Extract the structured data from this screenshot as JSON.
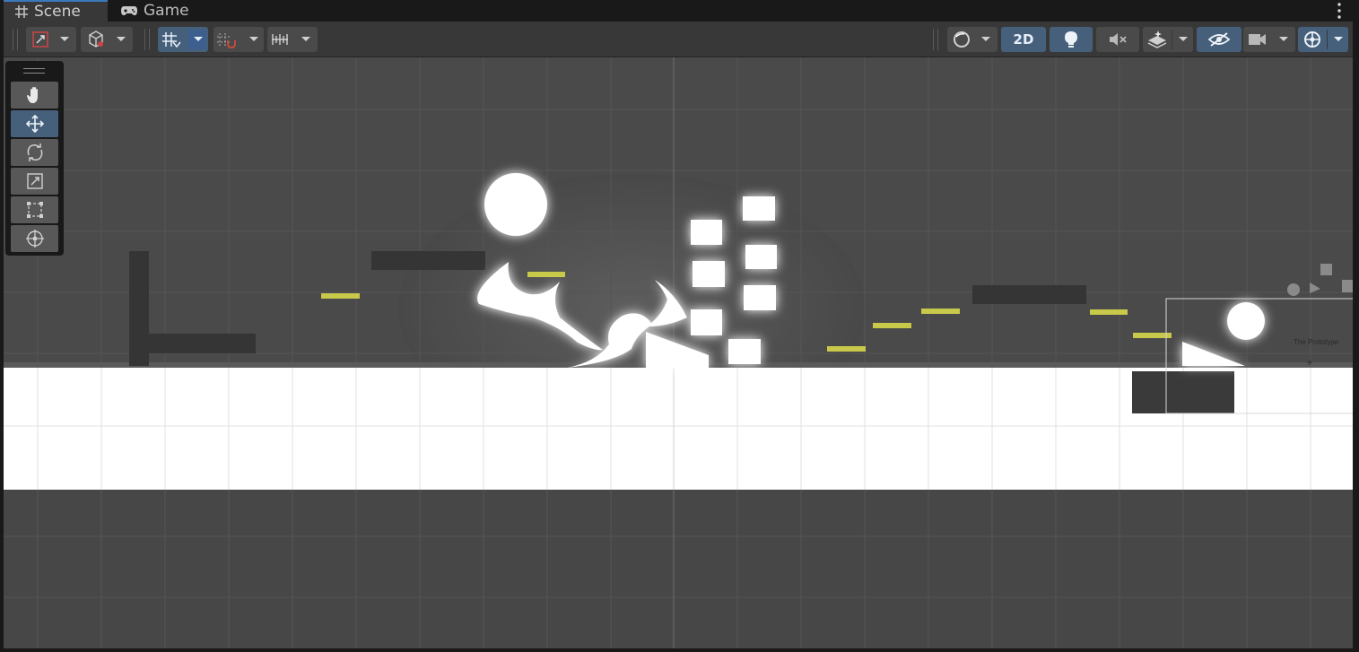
{
  "tabs": [
    {
      "label": "Scene",
      "icon": "grid-hash-icon",
      "active": true
    },
    {
      "label": "Game",
      "icon": "gamepad-icon",
      "active": false
    }
  ],
  "toolbar": {
    "view_2d_label": "2D",
    "left_buttons": [
      {
        "name": "transform-pivot-button",
        "icon": "pivot-icon",
        "dropdown": true,
        "active": false
      },
      {
        "name": "global-local-button",
        "icon": "cube-icon",
        "dropdown": true,
        "active": false
      },
      {
        "name": "grid-snapping-button",
        "icon": "grid-snap-icon",
        "dropdown": true,
        "active": true
      },
      {
        "name": "increment-snap-button",
        "icon": "snap-increment-icon",
        "dropdown": true,
        "active": false
      },
      {
        "name": "ruler-button",
        "icon": "ruler-icon",
        "dropdown": true,
        "active": false
      }
    ],
    "right_buttons": [
      {
        "name": "draw-mode-button",
        "icon": "shading-sphere-icon",
        "dropdown": true,
        "active": false
      },
      {
        "name": "2d-toggle-button",
        "icon": "",
        "dropdown": false,
        "active": true
      },
      {
        "name": "lighting-toggle-button",
        "icon": "lightbulb-icon",
        "dropdown": false,
        "active": true
      },
      {
        "name": "audio-toggle-button",
        "icon": "audio-mute-icon",
        "dropdown": false,
        "active": false
      },
      {
        "name": "effects-button",
        "icon": "layers-effects-icon",
        "dropdown": true,
        "active": false
      },
      {
        "name": "scene-visibility-button",
        "icon": "eye-hidden-icon",
        "dropdown": false,
        "active": true
      },
      {
        "name": "camera-button",
        "icon": "camera-icon",
        "dropdown": true,
        "active": false
      },
      {
        "name": "gizmos-button",
        "icon": "gizmo-globe-icon",
        "dropdown": true,
        "active": true
      }
    ]
  },
  "tools": [
    {
      "name": "hand-tool",
      "icon": "hand-icon",
      "active": false
    },
    {
      "name": "move-tool",
      "icon": "move-arrows-icon",
      "active": true
    },
    {
      "name": "rotate-tool",
      "icon": "rotate-icon",
      "active": false
    },
    {
      "name": "scale-tool",
      "icon": "scale-icon",
      "active": false
    },
    {
      "name": "rect-tool",
      "icon": "rect-transform-icon",
      "active": false
    },
    {
      "name": "transform-tool",
      "icon": "transform-combined-icon",
      "active": false
    }
  ],
  "scene": {
    "camera_label": "The Prototype",
    "colors": {
      "background": "#474747",
      "ground": "#ffffff",
      "platform_dark": "#353535",
      "yellow_platform": "#c8c84a",
      "sprite_white": "#ffffff"
    }
  }
}
